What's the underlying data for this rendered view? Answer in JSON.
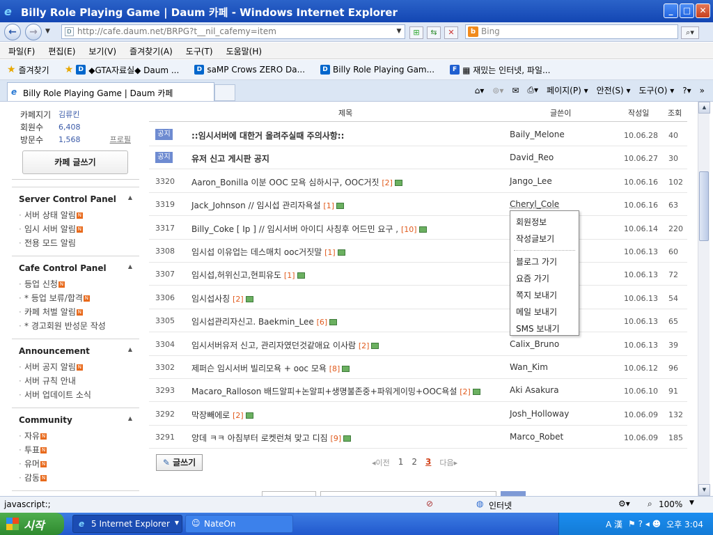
{
  "window": {
    "title": "Billy Role Playing Game | Daum 카페 - Windows Internet Explorer",
    "min": "_",
    "max": "□",
    "close": "✕"
  },
  "address": {
    "url": "http://cafe.daum.net/BRPG?t__nil_cafemy=item",
    "search_placeholder": "Bing",
    "back": "←",
    "forward": "→"
  },
  "menu": [
    "파일(F)",
    "편집(E)",
    "보기(V)",
    "즐겨찾기(A)",
    "도구(T)",
    "도움말(H)"
  ],
  "favorites": {
    "label": "즐겨찾기",
    "items": [
      "◆GTA자료실◆ Daum ...",
      "saMP Crows ZERO Da...",
      "Billy Role Playing Gam...",
      "▦ 재밌는 인터넷, 파일..."
    ]
  },
  "tab": {
    "title": "Billy Role Playing Game | Daum 카페"
  },
  "commands": [
    "페이지(P) ▾",
    "안전(S) ▾",
    "도구(O) ▾",
    "?▾",
    "»"
  ],
  "sidebar": {
    "manager_label": "카페지기",
    "manager": "김류킨",
    "members_label": "회원수",
    "members": "6,408",
    "visitors_label": "방문수",
    "visitors": "1,568",
    "profile": "프로필",
    "write": "카페 글쓰기",
    "panels": [
      {
        "title": "Server Control Panel",
        "items": [
          {
            "label": "서버 상태 알림",
            "new": true
          },
          {
            "label": "임시 서버 알림",
            "new": true
          },
          {
            "label": "전용 모드 알림",
            "new": false
          }
        ]
      },
      {
        "title": "Cafe Control Panel",
        "items": [
          {
            "label": "등업 신청",
            "new": true
          },
          {
            "label": "* 등업 보류/합격",
            "new": true
          },
          {
            "label": "카페 처벌 알림",
            "new": true
          },
          {
            "label": "* 경고회원 반성문 작성",
            "new": false
          }
        ]
      },
      {
        "title": "Announcement",
        "items": [
          {
            "label": "서버 공지 알림",
            "new": true
          },
          {
            "label": "서버 규칙 안내",
            "new": false
          },
          {
            "label": "서버 업데이트 소식",
            "new": false
          }
        ]
      },
      {
        "title": "Community",
        "items": [
          {
            "label": "자유",
            "new": true
          },
          {
            "label": "투표",
            "new": true
          },
          {
            "label": "유머",
            "new": true
          },
          {
            "label": "감동",
            "new": true
          }
        ]
      }
    ]
  },
  "board": {
    "headers": {
      "title": "제목",
      "writer": "글쓴이",
      "date": "작성일",
      "views": "조회"
    },
    "notice_label": "공지",
    "rows": [
      {
        "num": "공지",
        "notice": true,
        "title": "::임시서버에 대한거 올려주실때 주의사항::",
        "comments": "",
        "img": false,
        "writer": "Baily_Melone",
        "date": "10.06.28",
        "views": "40"
      },
      {
        "num": "공지",
        "notice": true,
        "title": "유저 신고 게시판 공지",
        "comments": "",
        "img": false,
        "writer": "David_Reo",
        "date": "10.06.27",
        "views": "30"
      },
      {
        "num": "3320",
        "notice": false,
        "title": "Aaron_Bonilla 이분 OOC 모욕 심하시구, OOC거짓",
        "comments": "[2]",
        "img": true,
        "writer": "Jango_Lee",
        "date": "10.06.16",
        "views": "102"
      },
      {
        "num": "3319",
        "notice": false,
        "title": "Jack_Johnson // 임시섭 관리자욕설",
        "comments": "[1]",
        "img": true,
        "writer": "Cheryl_Cole",
        "date": "10.06.16",
        "views": "63"
      },
      {
        "num": "3317",
        "notice": false,
        "title": "Billy_Coke [ Ip ] // 임시서버 아이디 사칭후 어드민 요구 ,",
        "comments": "[10]",
        "img": true,
        "writer": "",
        "date": "10.06.14",
        "views": "220"
      },
      {
        "num": "3308",
        "notice": false,
        "title": "임시섭 이유업는 데스매치 ooc거짓말",
        "comments": "[1]",
        "img": true,
        "writer": "",
        "date": "10.06.13",
        "views": "60"
      },
      {
        "num": "3307",
        "notice": false,
        "title": "임시섭,허위신고,현피유도",
        "comments": "[1]",
        "img": true,
        "writer": "",
        "date": "10.06.13",
        "views": "72"
      },
      {
        "num": "3306",
        "notice": false,
        "title": "임시섭사칭",
        "comments": "[2]",
        "img": true,
        "writer": "",
        "date": "10.06.13",
        "views": "54"
      },
      {
        "num": "3305",
        "notice": false,
        "title": "임시섭관리자신고. Baekmin_Lee",
        "comments": "[6]",
        "img": true,
        "writer": "",
        "date": "10.06.13",
        "views": "65"
      },
      {
        "num": "3304",
        "notice": false,
        "title": "임시서버유저 신고, 관리자였던것같애요 이사람",
        "comments": "[2]",
        "img": true,
        "writer": "Calix_Bruno",
        "date": "10.06.13",
        "views": "39"
      },
      {
        "num": "3302",
        "notice": false,
        "title": "제퍼슨 임시서버 빌리모욕 + ooc 모욕",
        "comments": "[8]",
        "img": true,
        "writer": "Wan_Kim",
        "date": "10.06.12",
        "views": "96"
      },
      {
        "num": "3293",
        "notice": false,
        "title": "Macaro_Ralloson 배드알피+논알피+생명불존중+파워게이밍+OOC욕설",
        "comments": "[2]",
        "img": true,
        "writer": "Aki Asakura",
        "date": "10.06.10",
        "views": "91"
      },
      {
        "num": "3292",
        "notice": false,
        "title": "막장빼에로",
        "comments": "[2]",
        "img": true,
        "writer": "Josh_Holloway",
        "date": "10.06.09",
        "views": "132"
      },
      {
        "num": "3291",
        "notice": false,
        "title": "앙데 ㅋㅋ 아침부터 로켓런쳐 맞고 디짐",
        "comments": "[9]",
        "img": true,
        "writer": "Marco_Robet",
        "date": "10.06.09",
        "views": "185"
      }
    ],
    "write_button": "글쓰기",
    "pager": {
      "prev": "◂이전",
      "pages": [
        "1",
        "2",
        "3"
      ],
      "current": "3",
      "next": "다음▸"
    }
  },
  "context_menu": {
    "group1": [
      "회원정보",
      "작성글보기"
    ],
    "group2": [
      "블로그 가기",
      "요즘 가기",
      "쪽지 보내기",
      "메일 보내기",
      "SMS 보내기"
    ]
  },
  "status": {
    "text": "javascript:;",
    "zone": "인터넷",
    "zoom": "100%"
  },
  "taskbar": {
    "start": "시작",
    "items": [
      "5 Internet Explorer",
      "NateOn"
    ],
    "time": "오후 3:04",
    "ime": "A 漢"
  }
}
